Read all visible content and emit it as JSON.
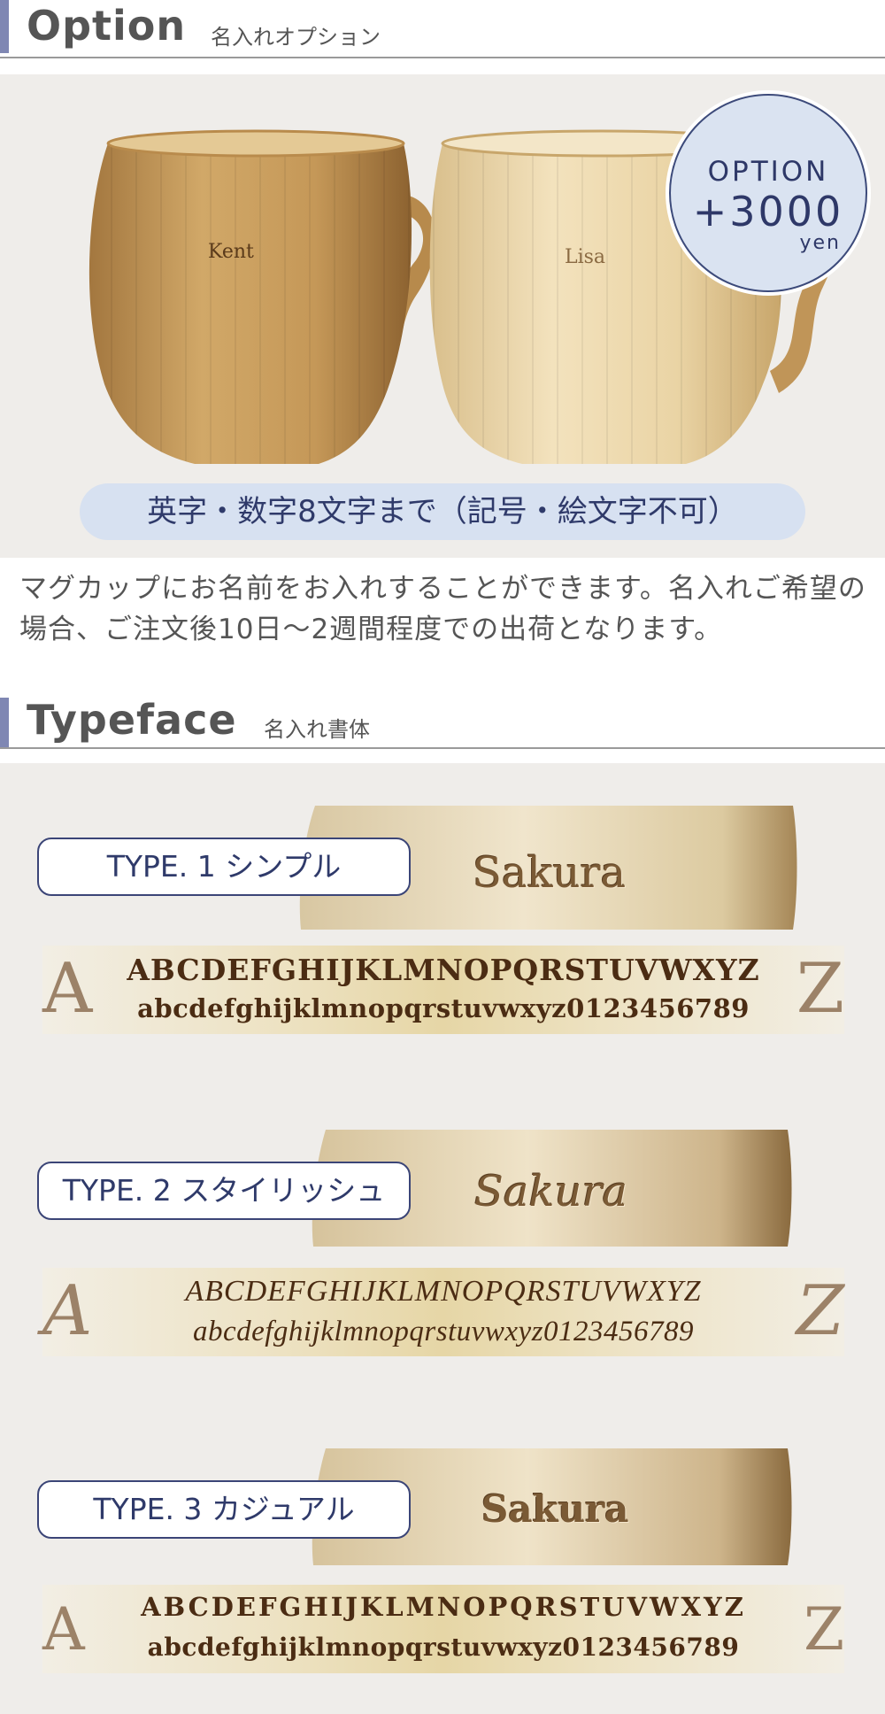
{
  "option_section": {
    "title": "Option",
    "subtitle": "名入れオプション",
    "badge": {
      "line1": "OPTION",
      "line2": "+3000",
      "line3": "yen"
    },
    "mug_names": [
      "Kent",
      "Lisa"
    ],
    "limit_note": "英字・数字8文字まで（記号・絵文字不可）",
    "description": "マグカップにお名前をお入れすることができます。名入れご希望の場合、ご注文後10日〜2週間程度での出荷となります。"
  },
  "typeface_section": {
    "title": "Typeface",
    "subtitle": "名入れ書体",
    "types": [
      {
        "label": "TYPE. 1 シンプル",
        "sample": "Sakura",
        "big_a": "A",
        "big_z": "Z",
        "uppercase": "ABCDEFGHIJKLMNOPQRSTUVWXYZ",
        "lowercase": "abcdefghijklmnopqrstuvwxyz0123456789"
      },
      {
        "label": "TYPE. 2 スタイリッシュ",
        "sample": "Sakura",
        "big_a": "A",
        "big_z": "Z",
        "uppercase": "ABCDEFGHIJKLMNOPQRSTUVWXYZ",
        "lowercase": "abcdefghijklmnopqrstuvwxyz0123456789"
      },
      {
        "label": "TYPE. 3 カジュアル",
        "sample": "Sakura",
        "big_a": "A",
        "big_z": "Z",
        "uppercase": "ABCDEFGHIJKLMNOPQRSTUVWXYZ",
        "lowercase": "abcdefghijklmnopqrstuvwxyz0123456789"
      }
    ]
  },
  "colors": {
    "accent_bar": "#7f87b3",
    "navy": "#2f3a6a",
    "panel_bg": "#efedea",
    "pill_bg": "#d7e1f1"
  }
}
